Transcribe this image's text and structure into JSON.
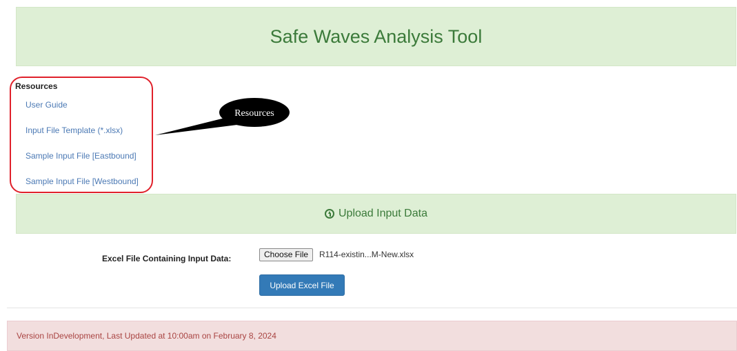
{
  "header": {
    "title": "Safe Waves Analysis Tool"
  },
  "resources": {
    "heading": "Resources",
    "links": [
      {
        "label": "User Guide"
      },
      {
        "label": "Input File Template (*.xlsx)"
      },
      {
        "label": "Sample Input File [Eastbound]"
      },
      {
        "label": "Sample Input File [Westbound]"
      }
    ]
  },
  "annotation": {
    "callout_label": "Resources",
    "highlight_color": "#e0202a"
  },
  "upload_section": {
    "icon": "circle-arrow-up-icon",
    "title": "Upload Input Data"
  },
  "form": {
    "file_label": "Excel File Containing Input Data:",
    "choose_button": "Choose File",
    "selected_file": "R114-existin...M-New.xlsx",
    "upload_button": "Upload Excel File"
  },
  "footer": {
    "text": "Version InDevelopment, Last Updated at 10:00am on February 8, 2024"
  },
  "colors": {
    "header_bg": "#deefd5",
    "header_text": "#3b7a3a",
    "link": "#4b79b4",
    "primary_button": "#337ab7",
    "footer_bg": "#f2dede",
    "footer_text": "#a94442"
  }
}
